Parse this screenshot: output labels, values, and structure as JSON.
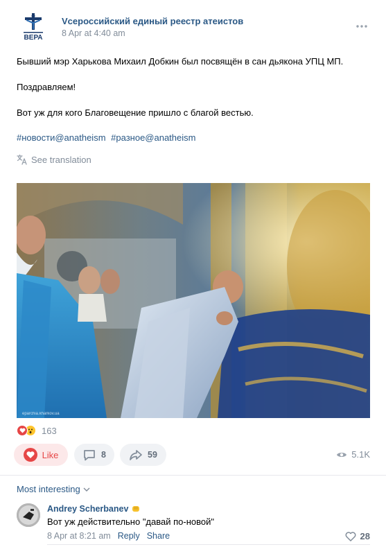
{
  "post": {
    "author": "Vсероссийский единый реестр атеистов",
    "date": "8 Apr at 4:40 am",
    "avatar_icon": "crucifix-logo",
    "avatar_text": "ВЕРА",
    "paragraphs": [
      "Бывший мэр Харькова Михаил Добкин был посвящён в сан дьякона УПЦ МП.",
      "Поздравляем!",
      "Вот уж для кого Благовещение пришло с благой вестью."
    ],
    "hashtags": [
      "#новости@anatheism",
      "#разное@anatheism"
    ],
    "translate_label": "See translation",
    "photo_watermark": "eparchia.kharkov.ua"
  },
  "reactions": {
    "icons": [
      "heart-reaction",
      "wow-reaction"
    ],
    "count": "163"
  },
  "actions": {
    "like_label": "Like",
    "comment_count": "8",
    "share_count": "59",
    "views": "5.1K"
  },
  "comments": {
    "sort_label": "Most interesting",
    "items": [
      {
        "author": "Andrey Scherbanev",
        "author_emoji": "fist-emoji",
        "text": "Вот уж действительно \"давай по-новой\"",
        "date": "8 Apr at 8:21 am",
        "reply_label": "Reply",
        "share_label": "Share",
        "likes": "28"
      }
    ]
  },
  "colors": {
    "link": "#2a5885",
    "secondary": "#818c99",
    "like_red": "#e64646",
    "like_bg": "#fce8e9",
    "button_bg": "#f0f2f5"
  }
}
